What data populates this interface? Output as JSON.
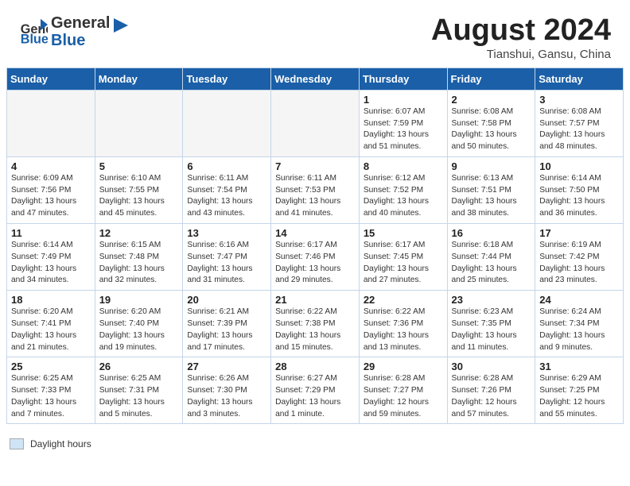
{
  "header": {
    "logo_general": "General",
    "logo_blue": "Blue",
    "month_title": "August 2024",
    "location": "Tianshui, Gansu, China"
  },
  "calendar": {
    "days_of_week": [
      "Sunday",
      "Monday",
      "Tuesday",
      "Wednesday",
      "Thursday",
      "Friday",
      "Saturday"
    ],
    "weeks": [
      [
        {
          "day": "",
          "info": ""
        },
        {
          "day": "",
          "info": ""
        },
        {
          "day": "",
          "info": ""
        },
        {
          "day": "",
          "info": ""
        },
        {
          "day": "1",
          "info": "Sunrise: 6:07 AM\nSunset: 7:59 PM\nDaylight: 13 hours\nand 51 minutes."
        },
        {
          "day": "2",
          "info": "Sunrise: 6:08 AM\nSunset: 7:58 PM\nDaylight: 13 hours\nand 50 minutes."
        },
        {
          "day": "3",
          "info": "Sunrise: 6:08 AM\nSunset: 7:57 PM\nDaylight: 13 hours\nand 48 minutes."
        }
      ],
      [
        {
          "day": "4",
          "info": "Sunrise: 6:09 AM\nSunset: 7:56 PM\nDaylight: 13 hours\nand 47 minutes."
        },
        {
          "day": "5",
          "info": "Sunrise: 6:10 AM\nSunset: 7:55 PM\nDaylight: 13 hours\nand 45 minutes."
        },
        {
          "day": "6",
          "info": "Sunrise: 6:11 AM\nSunset: 7:54 PM\nDaylight: 13 hours\nand 43 minutes."
        },
        {
          "day": "7",
          "info": "Sunrise: 6:11 AM\nSunset: 7:53 PM\nDaylight: 13 hours\nand 41 minutes."
        },
        {
          "day": "8",
          "info": "Sunrise: 6:12 AM\nSunset: 7:52 PM\nDaylight: 13 hours\nand 40 minutes."
        },
        {
          "day": "9",
          "info": "Sunrise: 6:13 AM\nSunset: 7:51 PM\nDaylight: 13 hours\nand 38 minutes."
        },
        {
          "day": "10",
          "info": "Sunrise: 6:14 AM\nSunset: 7:50 PM\nDaylight: 13 hours\nand 36 minutes."
        }
      ],
      [
        {
          "day": "11",
          "info": "Sunrise: 6:14 AM\nSunset: 7:49 PM\nDaylight: 13 hours\nand 34 minutes."
        },
        {
          "day": "12",
          "info": "Sunrise: 6:15 AM\nSunset: 7:48 PM\nDaylight: 13 hours\nand 32 minutes."
        },
        {
          "day": "13",
          "info": "Sunrise: 6:16 AM\nSunset: 7:47 PM\nDaylight: 13 hours\nand 31 minutes."
        },
        {
          "day": "14",
          "info": "Sunrise: 6:17 AM\nSunset: 7:46 PM\nDaylight: 13 hours\nand 29 minutes."
        },
        {
          "day": "15",
          "info": "Sunrise: 6:17 AM\nSunset: 7:45 PM\nDaylight: 13 hours\nand 27 minutes."
        },
        {
          "day": "16",
          "info": "Sunrise: 6:18 AM\nSunset: 7:44 PM\nDaylight: 13 hours\nand 25 minutes."
        },
        {
          "day": "17",
          "info": "Sunrise: 6:19 AM\nSunset: 7:42 PM\nDaylight: 13 hours\nand 23 minutes."
        }
      ],
      [
        {
          "day": "18",
          "info": "Sunrise: 6:20 AM\nSunset: 7:41 PM\nDaylight: 13 hours\nand 21 minutes."
        },
        {
          "day": "19",
          "info": "Sunrise: 6:20 AM\nSunset: 7:40 PM\nDaylight: 13 hours\nand 19 minutes."
        },
        {
          "day": "20",
          "info": "Sunrise: 6:21 AM\nSunset: 7:39 PM\nDaylight: 13 hours\nand 17 minutes."
        },
        {
          "day": "21",
          "info": "Sunrise: 6:22 AM\nSunset: 7:38 PM\nDaylight: 13 hours\nand 15 minutes."
        },
        {
          "day": "22",
          "info": "Sunrise: 6:22 AM\nSunset: 7:36 PM\nDaylight: 13 hours\nand 13 minutes."
        },
        {
          "day": "23",
          "info": "Sunrise: 6:23 AM\nSunset: 7:35 PM\nDaylight: 13 hours\nand 11 minutes."
        },
        {
          "day": "24",
          "info": "Sunrise: 6:24 AM\nSunset: 7:34 PM\nDaylight: 13 hours\nand 9 minutes."
        }
      ],
      [
        {
          "day": "25",
          "info": "Sunrise: 6:25 AM\nSunset: 7:33 PM\nDaylight: 13 hours\nand 7 minutes."
        },
        {
          "day": "26",
          "info": "Sunrise: 6:25 AM\nSunset: 7:31 PM\nDaylight: 13 hours\nand 5 minutes."
        },
        {
          "day": "27",
          "info": "Sunrise: 6:26 AM\nSunset: 7:30 PM\nDaylight: 13 hours\nand 3 minutes."
        },
        {
          "day": "28",
          "info": "Sunrise: 6:27 AM\nSunset: 7:29 PM\nDaylight: 13 hours\nand 1 minute."
        },
        {
          "day": "29",
          "info": "Sunrise: 6:28 AM\nSunset: 7:27 PM\nDaylight: 12 hours\nand 59 minutes."
        },
        {
          "day": "30",
          "info": "Sunrise: 6:28 AM\nSunset: 7:26 PM\nDaylight: 12 hours\nand 57 minutes."
        },
        {
          "day": "31",
          "info": "Sunrise: 6:29 AM\nSunset: 7:25 PM\nDaylight: 12 hours\nand 55 minutes."
        }
      ]
    ]
  },
  "footer": {
    "legend_label": "Daylight hours"
  }
}
